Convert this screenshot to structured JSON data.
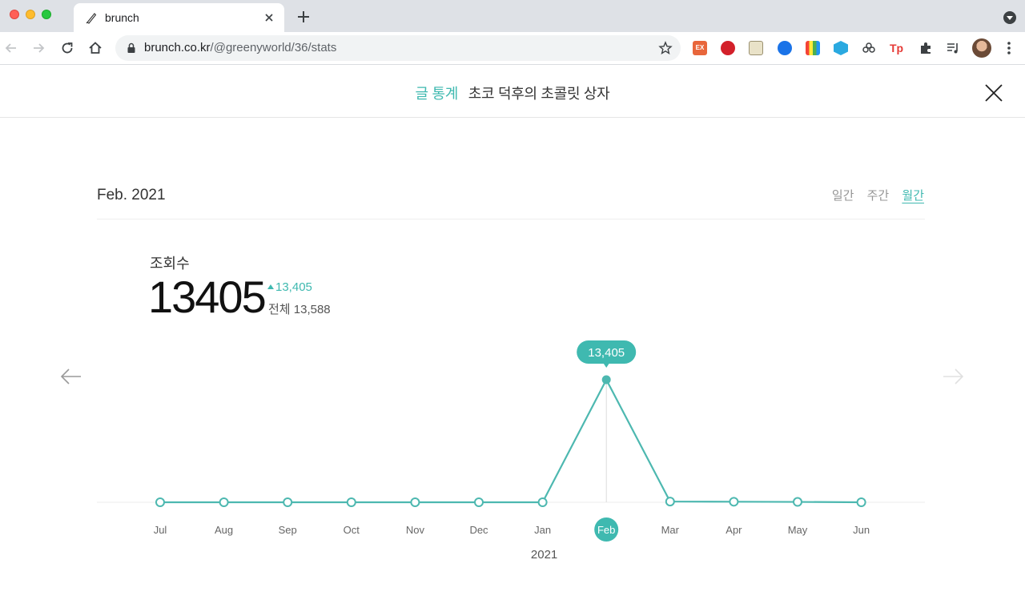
{
  "browser": {
    "tab_title": "brunch",
    "url_host": "brunch.co.kr",
    "url_path": "/@greenyworld/36/stats"
  },
  "header": {
    "section": "글 통계",
    "post_title": "초코 덕후의 초콜릿 상자"
  },
  "period": {
    "label": "Feb. 2021",
    "tabs": [
      "일간",
      "주간",
      "월간"
    ],
    "active_tab": "월간"
  },
  "metric": {
    "label": "조회수",
    "value": "13405",
    "delta": "13,405",
    "total": "전체 13,588"
  },
  "colors": {
    "accent": "#3fb9b0",
    "line": "#4db8b0"
  },
  "chart_data": {
    "type": "line",
    "categories": [
      "Jul",
      "Aug",
      "Sep",
      "Oct",
      "Nov",
      "Dec",
      "Jan",
      "Feb",
      "Mar",
      "Apr",
      "May",
      "Jun"
    ],
    "values": [
      0,
      0,
      0,
      0,
      0,
      0,
      0,
      13405,
      80,
      60,
      40,
      0
    ],
    "year_label": "2021",
    "highlight_index": 7,
    "highlight_label": "13,405"
  }
}
